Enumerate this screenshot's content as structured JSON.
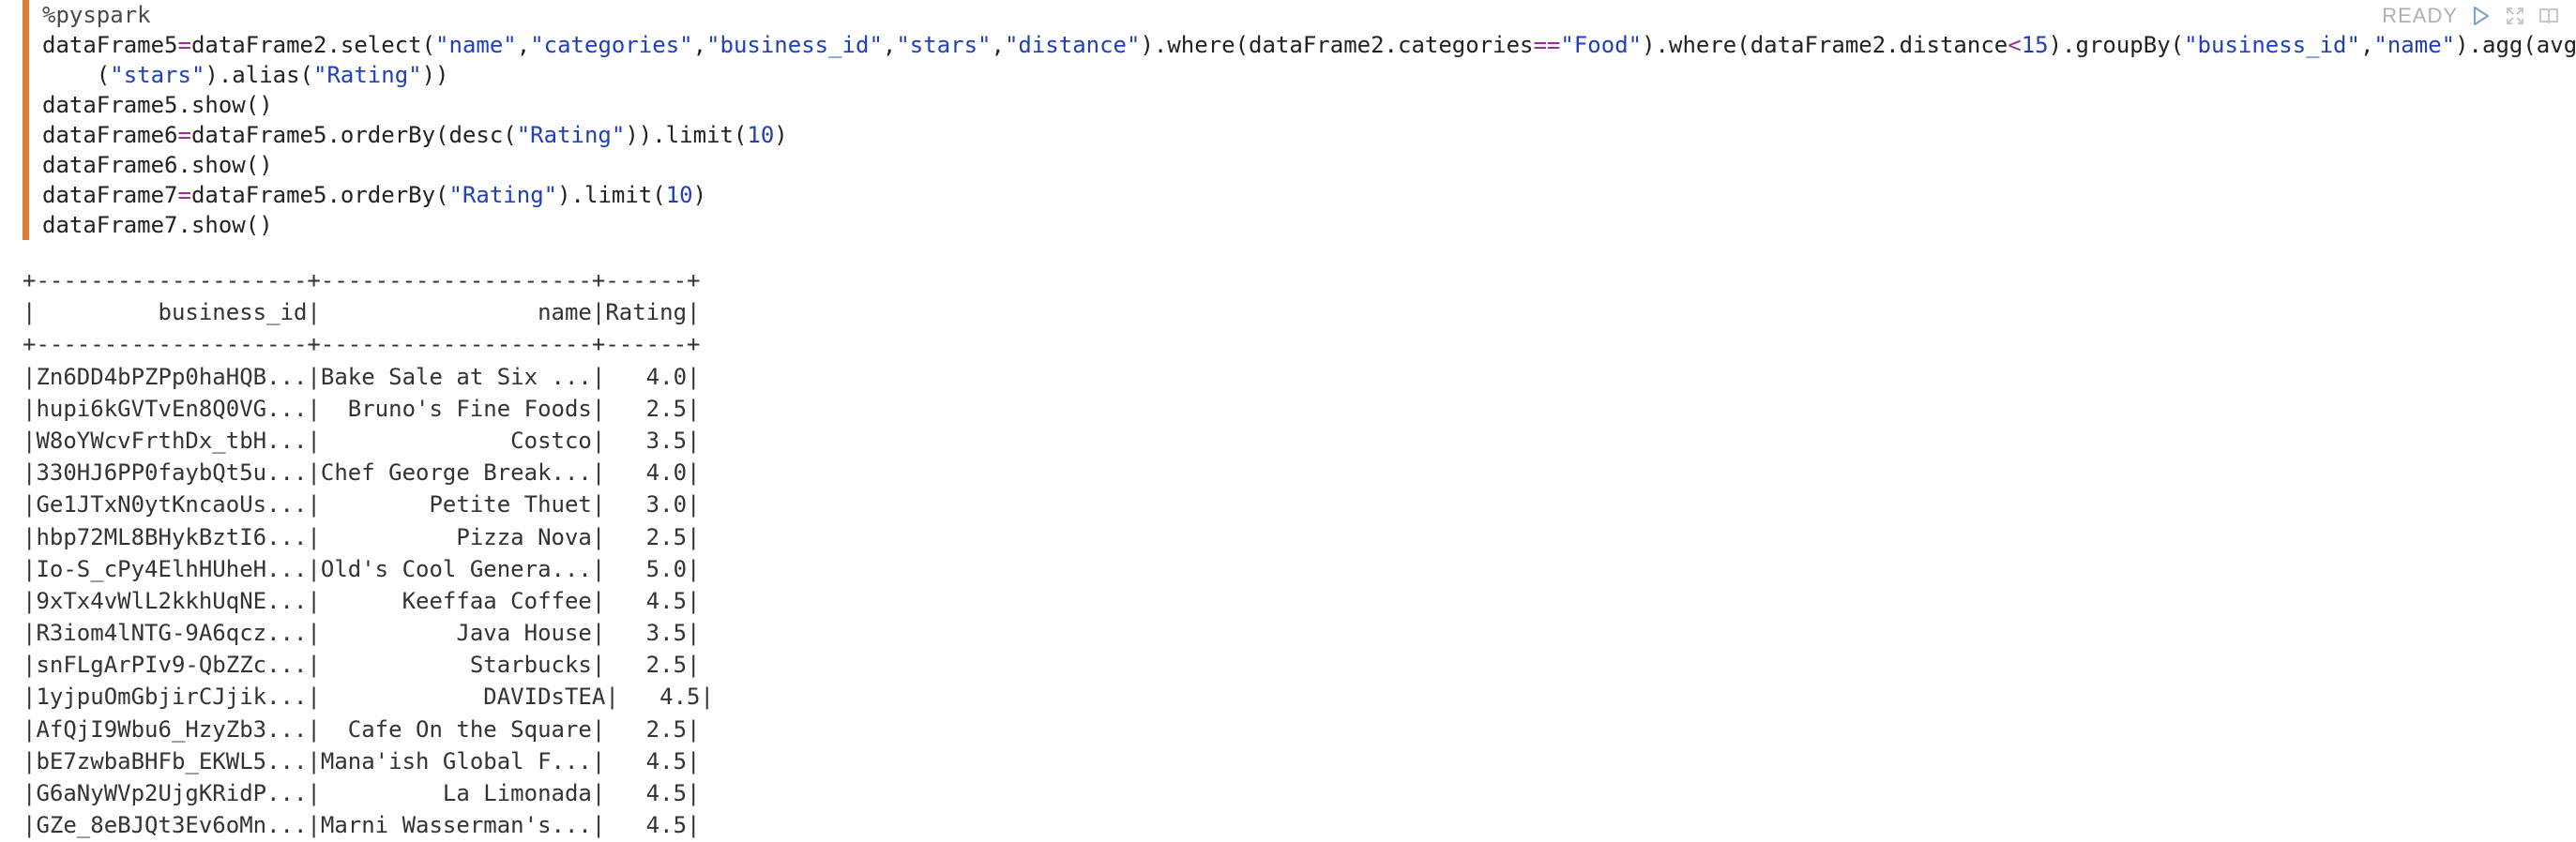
{
  "status": {
    "label": "READY",
    "icons": [
      "play-icon",
      "expand-icon",
      "book-icon"
    ]
  },
  "colors": {
    "editor_accent": "#e07a2e",
    "string": "#1f3fbf",
    "operator": "#a02a9a",
    "status_text": "#b0b0b0"
  },
  "code": {
    "lines": [
      [
        {
          "t": "%pyspark",
          "k": "dir"
        }
      ],
      [
        {
          "t": "dataFrame5",
          "k": ""
        },
        {
          "t": "=",
          "k": "op"
        },
        {
          "t": "dataFrame2.select(",
          "k": ""
        },
        {
          "t": "\"name\"",
          "k": "str"
        },
        {
          "t": ",",
          "k": ""
        },
        {
          "t": "\"categories\"",
          "k": "str"
        },
        {
          "t": ",",
          "k": ""
        },
        {
          "t": "\"business_id\"",
          "k": "str"
        },
        {
          "t": ",",
          "k": ""
        },
        {
          "t": "\"stars\"",
          "k": "str"
        },
        {
          "t": ",",
          "k": ""
        },
        {
          "t": "\"distance\"",
          "k": "str"
        },
        {
          "t": ").where(dataFrame2.categories",
          "k": ""
        },
        {
          "t": "==",
          "k": "op"
        },
        {
          "t": "\"Food\"",
          "k": "str"
        },
        {
          "t": ").where(dataFrame2.distance",
          "k": ""
        },
        {
          "t": "<",
          "k": "op"
        },
        {
          "t": "15",
          "k": "num"
        },
        {
          "t": ").groupBy(",
          "k": ""
        },
        {
          "t": "\"business_id\"",
          "k": "str"
        },
        {
          "t": ",",
          "k": ""
        },
        {
          "t": "\"name\"",
          "k": "str"
        },
        {
          "t": ").agg(avg",
          "k": ""
        }
      ],
      [
        {
          "t": "    (",
          "k": ""
        },
        {
          "t": "\"stars\"",
          "k": "str"
        },
        {
          "t": ").alias(",
          "k": ""
        },
        {
          "t": "\"Rating\"",
          "k": "str"
        },
        {
          "t": "))",
          "k": ""
        }
      ],
      [
        {
          "t": "dataFrame5.show()",
          "k": ""
        }
      ],
      [
        {
          "t": "dataFrame6",
          "k": ""
        },
        {
          "t": "=",
          "k": "op"
        },
        {
          "t": "dataFrame5.orderBy(desc(",
          "k": ""
        },
        {
          "t": "\"Rating\"",
          "k": "str"
        },
        {
          "t": ")).limit(",
          "k": ""
        },
        {
          "t": "10",
          "k": "num"
        },
        {
          "t": ")",
          "k": ""
        }
      ],
      [
        {
          "t": "dataFrame6.show()",
          "k": ""
        }
      ],
      [
        {
          "t": "dataFrame7",
          "k": ""
        },
        {
          "t": "=",
          "k": "op"
        },
        {
          "t": "dataFrame5.orderBy(",
          "k": ""
        },
        {
          "t": "\"Rating\"",
          "k": "str"
        },
        {
          "t": ").limit(",
          "k": ""
        },
        {
          "t": "10",
          "k": "num"
        },
        {
          "t": ")",
          "k": ""
        }
      ],
      [
        {
          "t": "dataFrame7.show()",
          "k": ""
        }
      ]
    ]
  },
  "output": {
    "lines": [
      "+--------------------+--------------------+------+",
      "|         business_id|                name|Rating|",
      "+--------------------+--------------------+------+",
      "|Zn6DD4bPZPp0haHQB...|Bake Sale at Six ...|   4.0|",
      "|hupi6kGVTvEn8Q0VG...|  Bruno's Fine Foods|   2.5|",
      "|W8oYWcvFrthDx_tbH...|              Costco|   3.5|",
      "|330HJ6PP0faybQt5u...|Chef George Break...|   4.0|",
      "|Ge1JTxN0ytKncaoUs...|        Petite Thuet|   3.0|",
      "|hbp72ML8BHykBztI6...|          Pizza Nova|   2.5|",
      "|Io-S_cPy4ElhHUheH...|Old's Cool Genera...|   5.0|",
      "|9xTx4vWlL2kkhUqNE...|      Keeffaa Coffee|   4.5|",
      "|R3iom4lNTG-9A6qcz...|          Java House|   3.5|",
      "|snFLgArPIv9-QbZZc...|           Starbucks|   2.5|",
      "|1yjpuOmGbjirCJjik...|            DAVIDsTEA|   4.5|",
      "|AfQjI9Wbu6_HzyZb3...|  Cafe On the Square|   2.5|",
      "|bE7zwbaBHFb_EKWL5...|Mana'ish Global F...|   4.5|",
      "|G6aNyWVp2UjgKRidP...|         La Limonada|   4.5|",
      "|GZe_8eBJQt3Ev6oMn...|Marni Wasserman's...|   4.5|"
    ]
  }
}
